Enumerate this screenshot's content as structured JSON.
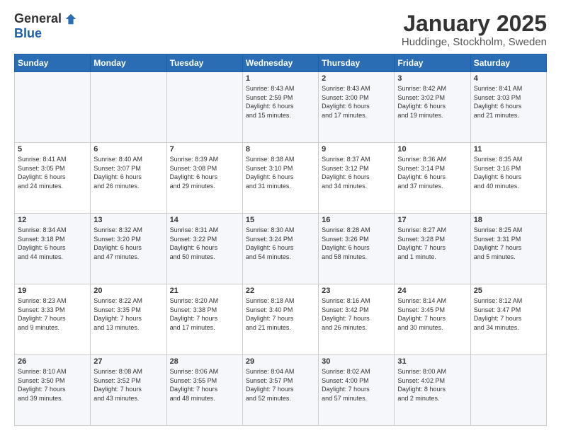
{
  "logo": {
    "general": "General",
    "blue": "Blue"
  },
  "header": {
    "month": "January 2025",
    "location": "Huddinge, Stockholm, Sweden"
  },
  "weekdays": [
    "Sunday",
    "Monday",
    "Tuesday",
    "Wednesday",
    "Thursday",
    "Friday",
    "Saturday"
  ],
  "weeks": [
    [
      {
        "day": "",
        "info": ""
      },
      {
        "day": "",
        "info": ""
      },
      {
        "day": "",
        "info": ""
      },
      {
        "day": "1",
        "info": "Sunrise: 8:43 AM\nSunset: 2:59 PM\nDaylight: 6 hours\nand 15 minutes."
      },
      {
        "day": "2",
        "info": "Sunrise: 8:43 AM\nSunset: 3:00 PM\nDaylight: 6 hours\nand 17 minutes."
      },
      {
        "day": "3",
        "info": "Sunrise: 8:42 AM\nSunset: 3:02 PM\nDaylight: 6 hours\nand 19 minutes."
      },
      {
        "day": "4",
        "info": "Sunrise: 8:41 AM\nSunset: 3:03 PM\nDaylight: 6 hours\nand 21 minutes."
      }
    ],
    [
      {
        "day": "5",
        "info": "Sunrise: 8:41 AM\nSunset: 3:05 PM\nDaylight: 6 hours\nand 24 minutes."
      },
      {
        "day": "6",
        "info": "Sunrise: 8:40 AM\nSunset: 3:07 PM\nDaylight: 6 hours\nand 26 minutes."
      },
      {
        "day": "7",
        "info": "Sunrise: 8:39 AM\nSunset: 3:08 PM\nDaylight: 6 hours\nand 29 minutes."
      },
      {
        "day": "8",
        "info": "Sunrise: 8:38 AM\nSunset: 3:10 PM\nDaylight: 6 hours\nand 31 minutes."
      },
      {
        "day": "9",
        "info": "Sunrise: 8:37 AM\nSunset: 3:12 PM\nDaylight: 6 hours\nand 34 minutes."
      },
      {
        "day": "10",
        "info": "Sunrise: 8:36 AM\nSunset: 3:14 PM\nDaylight: 6 hours\nand 37 minutes."
      },
      {
        "day": "11",
        "info": "Sunrise: 8:35 AM\nSunset: 3:16 PM\nDaylight: 6 hours\nand 40 minutes."
      }
    ],
    [
      {
        "day": "12",
        "info": "Sunrise: 8:34 AM\nSunset: 3:18 PM\nDaylight: 6 hours\nand 44 minutes."
      },
      {
        "day": "13",
        "info": "Sunrise: 8:32 AM\nSunset: 3:20 PM\nDaylight: 6 hours\nand 47 minutes."
      },
      {
        "day": "14",
        "info": "Sunrise: 8:31 AM\nSunset: 3:22 PM\nDaylight: 6 hours\nand 50 minutes."
      },
      {
        "day": "15",
        "info": "Sunrise: 8:30 AM\nSunset: 3:24 PM\nDaylight: 6 hours\nand 54 minutes."
      },
      {
        "day": "16",
        "info": "Sunrise: 8:28 AM\nSunset: 3:26 PM\nDaylight: 6 hours\nand 58 minutes."
      },
      {
        "day": "17",
        "info": "Sunrise: 8:27 AM\nSunset: 3:28 PM\nDaylight: 7 hours\nand 1 minute."
      },
      {
        "day": "18",
        "info": "Sunrise: 8:25 AM\nSunset: 3:31 PM\nDaylight: 7 hours\nand 5 minutes."
      }
    ],
    [
      {
        "day": "19",
        "info": "Sunrise: 8:23 AM\nSunset: 3:33 PM\nDaylight: 7 hours\nand 9 minutes."
      },
      {
        "day": "20",
        "info": "Sunrise: 8:22 AM\nSunset: 3:35 PM\nDaylight: 7 hours\nand 13 minutes."
      },
      {
        "day": "21",
        "info": "Sunrise: 8:20 AM\nSunset: 3:38 PM\nDaylight: 7 hours\nand 17 minutes."
      },
      {
        "day": "22",
        "info": "Sunrise: 8:18 AM\nSunset: 3:40 PM\nDaylight: 7 hours\nand 21 minutes."
      },
      {
        "day": "23",
        "info": "Sunrise: 8:16 AM\nSunset: 3:42 PM\nDaylight: 7 hours\nand 26 minutes."
      },
      {
        "day": "24",
        "info": "Sunrise: 8:14 AM\nSunset: 3:45 PM\nDaylight: 7 hours\nand 30 minutes."
      },
      {
        "day": "25",
        "info": "Sunrise: 8:12 AM\nSunset: 3:47 PM\nDaylight: 7 hours\nand 34 minutes."
      }
    ],
    [
      {
        "day": "26",
        "info": "Sunrise: 8:10 AM\nSunset: 3:50 PM\nDaylight: 7 hours\nand 39 minutes."
      },
      {
        "day": "27",
        "info": "Sunrise: 8:08 AM\nSunset: 3:52 PM\nDaylight: 7 hours\nand 43 minutes."
      },
      {
        "day": "28",
        "info": "Sunrise: 8:06 AM\nSunset: 3:55 PM\nDaylight: 7 hours\nand 48 minutes."
      },
      {
        "day": "29",
        "info": "Sunrise: 8:04 AM\nSunset: 3:57 PM\nDaylight: 7 hours\nand 52 minutes."
      },
      {
        "day": "30",
        "info": "Sunrise: 8:02 AM\nSunset: 4:00 PM\nDaylight: 7 hours\nand 57 minutes."
      },
      {
        "day": "31",
        "info": "Sunrise: 8:00 AM\nSunset: 4:02 PM\nDaylight: 8 hours\nand 2 minutes."
      },
      {
        "day": "",
        "info": ""
      }
    ]
  ]
}
